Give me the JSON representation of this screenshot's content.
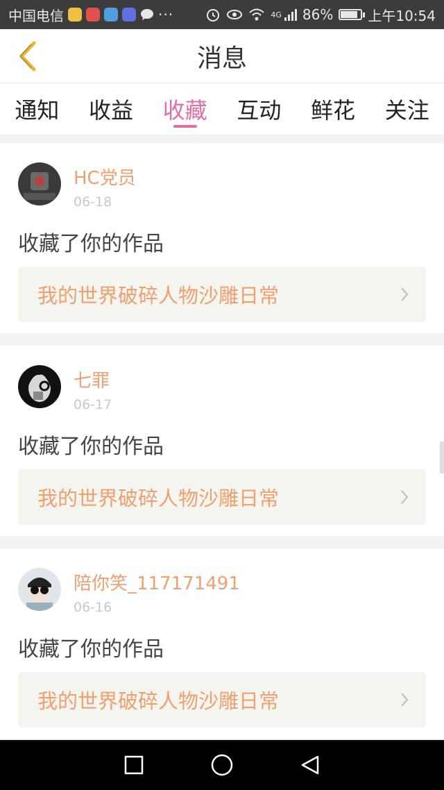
{
  "status_bar": {
    "carrier": "中国电信",
    "more": "···",
    "network": "4G",
    "battery": "86%",
    "battery_level": 0.86,
    "time": "上午10:54",
    "app_icon_colors": [
      "#f0c040",
      "#e05050",
      "#50a0e0",
      "#6070e0"
    ]
  },
  "header": {
    "title": "消息"
  },
  "tabs": [
    {
      "label": "通知",
      "active": false
    },
    {
      "label": "收益",
      "active": false
    },
    {
      "label": "收藏",
      "active": true
    },
    {
      "label": "互动",
      "active": false
    },
    {
      "label": "鲜花",
      "active": false
    },
    {
      "label": "关注",
      "active": false
    }
  ],
  "messages": [
    {
      "username": "HC党员",
      "date": "06-18",
      "action": "收藏了你的作品",
      "work_title": "我的世界破碎人物沙雕日常",
      "avatar_icon": "dark-photo-avatar"
    },
    {
      "username": "七罪",
      "date": "06-17",
      "action": "收藏了你的作品",
      "work_title": "我的世界破碎人物沙雕日常",
      "avatar_icon": "black-white-portrait-avatar"
    },
    {
      "username": "陪你笑_117171491",
      "date": "06-16",
      "action": "收藏了你的作品",
      "work_title": "我的世界破碎人物沙雕日常",
      "avatar_icon": "glasses-portrait-avatar"
    }
  ],
  "colors": {
    "accent": "#e36ea6",
    "username": "#f0a070",
    "back_arrow": "#e8b830"
  }
}
